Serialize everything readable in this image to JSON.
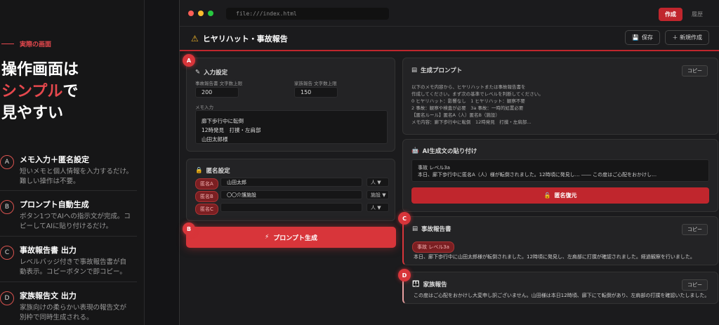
{
  "left": {
    "tag": "実際の画面",
    "hero": {
      "line1": "操作画面は",
      "line2_red": "シンプル",
      "line2_rest": "で",
      "line3": "見やすい"
    },
    "features": [
      {
        "num": "A",
        "title": "メモ入力＋匿名設定",
        "desc1": "短いメモと個人情報を入力するだけ。",
        "desc2": "難しい操作は不要。"
      },
      {
        "num": "B",
        "title": "プロンプト自動生成",
        "desc1": "ボタン1つでAIへの指示文が完成。コ",
        "desc2": "ピーしてAIに貼り付けるだけ。"
      },
      {
        "num": "C",
        "title": "事故報告書 出力",
        "desc1": "レベルバッジ付きで事故報告書が自",
        "desc2": "動表示。コピーボタンで即コピー。"
      },
      {
        "num": "D",
        "title": "家族報告文 出力",
        "desc1": "家族向けの柔らかい表現の報告文が",
        "desc2": "別枠で同時生成される。"
      }
    ]
  },
  "window": {
    "url": "file:///index.html",
    "tabs": [
      "作成",
      "履歴"
    ],
    "title": "ヒヤリハット・事故報告",
    "save": "保存",
    "new": "＋ 新規作成"
  },
  "input": {
    "title": "入力設定",
    "label1": "事故報告書 文字数上限",
    "value1": "200",
    "label2": "家族報告 文字数上限",
    "value2": "150",
    "memo_label": "メモ入力",
    "memo_lines": [
      "廊下歩行中に転倒",
      "12時発見　打撲・左肩部",
      "山田太郎様"
    ]
  },
  "anon": {
    "title": "匿名設定",
    "rows": [
      {
        "badge": "匿名A",
        "value": "山田太郎",
        "select": "人 ▼"
      },
      {
        "badge": "匿名B",
        "value": "〇〇介護施設",
        "select": "施設 ▼"
      },
      {
        "badge": "匿名C",
        "value": "",
        "select": "人 ▼"
      }
    ]
  },
  "gen_button": "プロンプト生成",
  "prompt_card": {
    "title": "生成プロンプト",
    "copy": "コピー",
    "lines": [
      "以下のメモ内容から、ヒヤリハットまたは事故報告書を",
      "作成してください。まず次の基準でレベルを判断してください。",
      "0  ヒヤリハット：影響なし　1  ヒヤリハット：観察不要",
      "2  事故：観察や検査が必要　3a  事故：一時的処置必要",
      "【匿名ルール】匿名A（人）匿名B（施設）",
      "メモ内容：廊下歩行中に転倒　12時発見　打撲・左肩部…"
    ]
  },
  "paste_card": {
    "title": "AI生成文の貼り付け",
    "line1": "事故 レベル3a",
    "line2": "本日、廊下歩行中に匿名A（人）様が転倒されました。12時頃に発見し… ―― この度はご心配をおかけし…",
    "restore": "匿名復元"
  },
  "report_card": {
    "title": "事故報告書",
    "copy": "コピー",
    "badge": "事故 レベル3a",
    "text": "本日、廊下歩行中に山田太郎様が転倒されました。12時頃に発見し、左肩部に打撲が確認されました。経過観察を行いました。"
  },
  "family_card": {
    "title": "家族報告",
    "copy": "コピー",
    "text": "この度はご心配をおかけし大変申し訳ございません。山田様は本日12時頃、廊下にて転倒があり、左肩部の打撲を確認いたしました。"
  },
  "markers": [
    "A",
    "B",
    "C",
    "D"
  ],
  "colors": {
    "accent": "#d8353a",
    "bg": "#141416"
  }
}
